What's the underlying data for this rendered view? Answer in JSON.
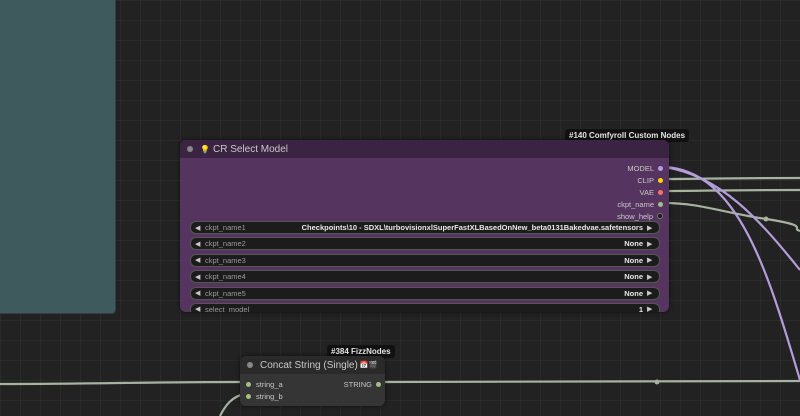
{
  "group": {
    "color": "#3e5a5c"
  },
  "cr_node": {
    "badge": "#140 Comfyroll Custom Nodes",
    "icon": "bulb-icon",
    "title": "CR Select Model",
    "outputs": [
      {
        "label": "MODEL",
        "color": "#b39ddb"
      },
      {
        "label": "CLIP",
        "color": "#ffd500"
      },
      {
        "label": "VAE",
        "color": "#ff6e6e"
      },
      {
        "label": "ckpt_name",
        "color": "#a1c181"
      },
      {
        "label": "show_help",
        "color": "#555555"
      }
    ],
    "widgets": [
      {
        "label": "ckpt_name1",
        "value": "Checkpoints\\10 - SDXL\\turbovisionxlSuperFastXLBasedOnNew_beta0131Bakedvae.safetensors"
      },
      {
        "label": "ckpt_name2",
        "value": "None"
      },
      {
        "label": "ckpt_name3",
        "value": "None"
      },
      {
        "label": "ckpt_name4",
        "value": "None"
      },
      {
        "label": "ckpt_name5",
        "value": "None"
      },
      {
        "label": "select_model",
        "value": "1"
      }
    ]
  },
  "fizz_node": {
    "badge": "#384 FizzNodes",
    "title": "Concat String (Single)",
    "title_icons": "📅🎬",
    "inputs": [
      {
        "label": "string_a",
        "color": "#a1c181"
      },
      {
        "label": "string_b",
        "color": "#a1c181"
      }
    ],
    "output": {
      "label": "STRING",
      "color": "#a1c181"
    }
  },
  "wires": {
    "string_color": "#a6b3a0",
    "model_color": "#b39ddb"
  }
}
